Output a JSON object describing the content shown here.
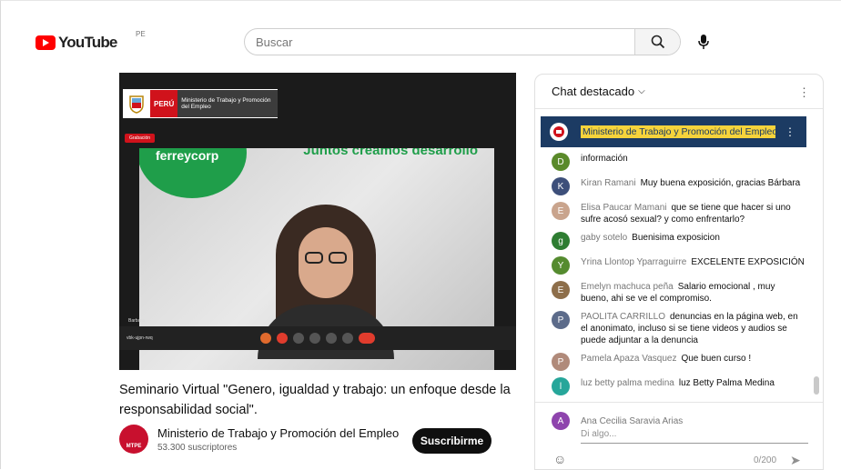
{
  "header": {
    "logo_text": "YouTube",
    "region": "PE",
    "search_placeholder": "Buscar"
  },
  "video": {
    "banner_country": "PERÚ",
    "banner_ministry": "Ministerio de Trabajo y Promoción del Empleo",
    "recording_label": "Grabación",
    "slide_brand": "ferreycorp",
    "slide_slogan": "Juntos creamos desarrollo",
    "participant_name": "Barbara",
    "meeting_id": "vbk-ujpn-rwq",
    "title": "Seminario Virtual \"Genero, igualdad y trabajo: un enfoque desde la responsabilidad social\"."
  },
  "channel": {
    "avatar_label": "MTPE",
    "name": "Ministerio de Trabajo y Promoción del Empleo",
    "subscribers": "53.300 suscriptores",
    "subscribe_label": "Suscribirme"
  },
  "chat": {
    "header": "Chat destacado",
    "pinned": "Ministerio de Trabajo y Promoción del Empleo",
    "messages": [
      {
        "author": "",
        "text": "información",
        "initial": "D",
        "color": "#5a8a2a"
      },
      {
        "author": "Kiran Ramani",
        "text": "Muy buena exposición, gracias Bárbara",
        "initial": "K",
        "color": "#3d4f7a"
      },
      {
        "author": "Elisa Paucar Mamani",
        "text": "que se tiene que hacer si uno sufre acosó sexual? y como enfrentarlo?",
        "initial": "E",
        "color": "#c9a48d"
      },
      {
        "author": "gaby sotelo",
        "text": "Buenisima exposicion",
        "initial": "g",
        "color": "#2e7d32"
      },
      {
        "author": "Yrina Llontop Yparraguirre",
        "text": "EXCELENTE EXPOSICIÓN",
        "initial": "Y",
        "color": "#558b2f"
      },
      {
        "author": "Emelyn machuca peña",
        "text": "Salario emocional , muy bueno, ahi se ve el compromiso.",
        "initial": "E",
        "color": "#8d6e4a"
      },
      {
        "author": "PAOLITA CARRILLO",
        "text": "denuncias en la página web, en el anonimato, incluso si se tiene videos y audios se puede adjuntar a la denuncia",
        "initial": "P",
        "color": "#5c6b8a"
      },
      {
        "author": "Pamela Apaza Vasquez",
        "text": "Que buen curso !",
        "initial": "P",
        "color": "#b08a7a"
      },
      {
        "author": "luz betty palma medina",
        "text": "luz Betty Palma Medina",
        "initial": "l",
        "color": "#26a69a"
      }
    ],
    "me_name": "Ana Cecilia Saravia Arias",
    "me_initial": "A",
    "input_placeholder": "Di algo...",
    "char_count": "0/200"
  }
}
